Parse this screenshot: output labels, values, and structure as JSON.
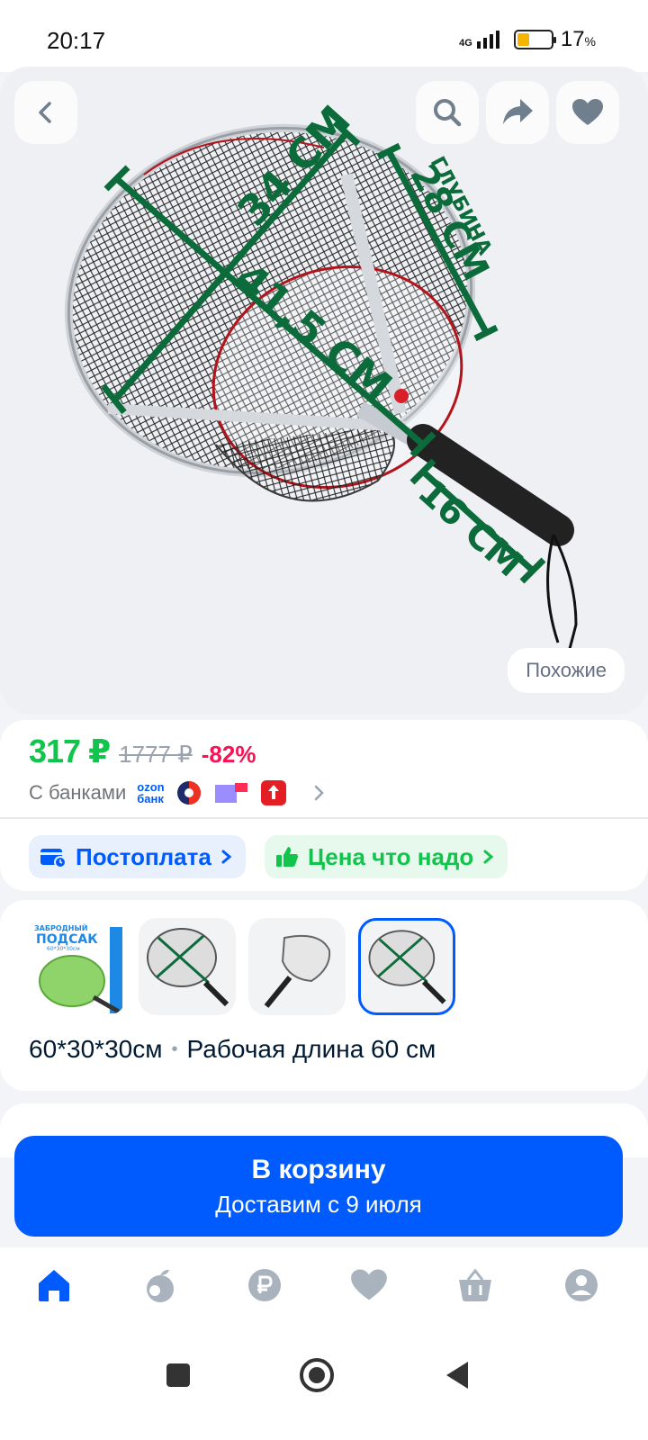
{
  "status_bar": {
    "time": "20:17",
    "network": "4G",
    "battery_percent": "17",
    "battery_unit": "%",
    "battery_level": 0.17
  },
  "gallery": {
    "back_icon": "chevron-left-icon",
    "search_icon": "search-icon",
    "share_icon": "share-icon",
    "favorite_icon": "heart-icon",
    "similar_label": "Похожие",
    "image_labels": {
      "width": "34 СМ",
      "depth_title": "ГЛУБИНА",
      "depth_value": "28 СМ",
      "diagonal": "41,5 СМ",
      "handle": "16 СМ"
    }
  },
  "price": {
    "current": "317 ₽",
    "old": "1777 ₽",
    "discount": "-82%",
    "banks_label": "С банками",
    "ozon_logo_top": "ozon",
    "ozon_logo_bottom": "банк"
  },
  "chips": {
    "postpay": "Постоплата",
    "price_ok": "Цена что надо"
  },
  "variants": {
    "thumb1_title": "ЗАБРОДНЫЙ",
    "thumb1_subtitle": "ПОДСАК",
    "thumb1_size": "60*30*30см",
    "size": "60*30*30см",
    "separator": "•",
    "work_length": "Рабочая длина 60 см"
  },
  "cart": {
    "button_label": "В корзину",
    "delivery": "Доставим с 9 июля"
  },
  "colors": {
    "brand_blue": "#005bff",
    "price_green": "#10c44c",
    "discount_pink": "#f91155",
    "net_green": "#0b6b3a"
  },
  "bottom_nav": [
    "home-icon",
    "fresh-icon",
    "ruble-icon",
    "heart-icon",
    "cart-icon",
    "profile-icon"
  ]
}
